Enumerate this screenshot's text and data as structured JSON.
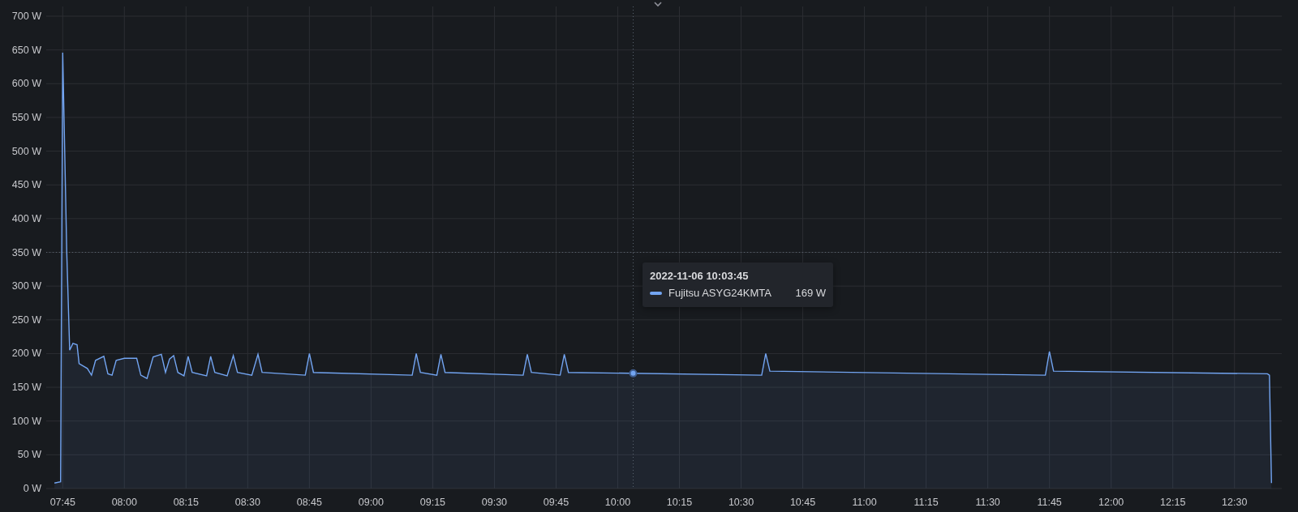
{
  "chart_data": {
    "type": "area",
    "grid": true,
    "xlim": [
      461,
      761.5
    ],
    "ylim": [
      0,
      700
    ],
    "ref_lines": [
      {
        "axis": "x",
        "value": 603.75
      },
      {
        "axis": "y",
        "value": 350
      }
    ],
    "yticks": [
      {
        "value": 0,
        "label": "0 W"
      },
      {
        "value": 50,
        "label": "50 W"
      },
      {
        "value": 100,
        "label": "100 W"
      },
      {
        "value": 150,
        "label": "150 W"
      },
      {
        "value": 200,
        "label": "200 W"
      },
      {
        "value": 250,
        "label": "250 W"
      },
      {
        "value": 300,
        "label": "300 W"
      },
      {
        "value": 350,
        "label": "350 W"
      },
      {
        "value": 400,
        "label": "400 W"
      },
      {
        "value": 450,
        "label": "450 W"
      },
      {
        "value": 500,
        "label": "500 W"
      },
      {
        "value": 550,
        "label": "550 W"
      },
      {
        "value": 600,
        "label": "600 W"
      },
      {
        "value": 650,
        "label": "650 W"
      },
      {
        "value": 700,
        "label": "700 W"
      }
    ],
    "xticks": [
      {
        "value": 465,
        "label": "07:45"
      },
      {
        "value": 480,
        "label": "08:00"
      },
      {
        "value": 495,
        "label": "08:15"
      },
      {
        "value": 510,
        "label": "08:30"
      },
      {
        "value": 525,
        "label": "08:45"
      },
      {
        "value": 540,
        "label": "09:00"
      },
      {
        "value": 555,
        "label": "09:15"
      },
      {
        "value": 570,
        "label": "09:30"
      },
      {
        "value": 585,
        "label": "09:45"
      },
      {
        "value": 600,
        "label": "10:00"
      },
      {
        "value": 615,
        "label": "10:15"
      },
      {
        "value": 630,
        "label": "10:30"
      },
      {
        "value": 645,
        "label": "10:45"
      },
      {
        "value": 660,
        "label": "11:00"
      },
      {
        "value": 675,
        "label": "11:15"
      },
      {
        "value": 690,
        "label": "11:30"
      },
      {
        "value": 705,
        "label": "11:45"
      },
      {
        "value": 720,
        "label": "12:00"
      },
      {
        "value": 735,
        "label": "12:15"
      },
      {
        "value": 750,
        "label": "12:30"
      }
    ],
    "x": [
      463,
      464.5,
      465,
      466,
      466.7,
      467.5,
      468.5,
      469,
      471,
      472,
      473,
      475,
      476,
      477,
      478,
      480,
      483,
      484,
      485.5,
      487,
      489,
      490,
      491,
      492,
      493,
      494.5,
      495.5,
      496.5,
      500,
      501,
      502,
      505,
      506.5,
      507.5,
      511,
      512.5,
      513.5,
      524,
      525,
      526,
      550,
      551,
      552,
      556,
      557,
      558,
      577,
      578,
      579,
      586,
      587,
      588,
      635,
      636,
      637,
      704,
      705,
      706,
      758,
      758.5,
      759
    ],
    "series": [
      {
        "name": "Fujitsu ASYG24KMTA",
        "color": "#73a5f2",
        "values": [
          8,
          10,
          646,
          350,
          205,
          215,
          213,
          185,
          178,
          168,
          190,
          196,
          170,
          168,
          190,
          193,
          193,
          168,
          163,
          195,
          199,
          172,
          192,
          197,
          172,
          167,
          196,
          172,
          167,
          196,
          172,
          167,
          197,
          172,
          168,
          199,
          172,
          168,
          200,
          172,
          168,
          200,
          172,
          168,
          199,
          172,
          168,
          199,
          172,
          168,
          199,
          172,
          168,
          200,
          174,
          168,
          203,
          174,
          170,
          168,
          8
        ]
      }
    ]
  },
  "tooltip": {
    "time": "2022-11-06 10:03:45",
    "value": "169 W"
  }
}
